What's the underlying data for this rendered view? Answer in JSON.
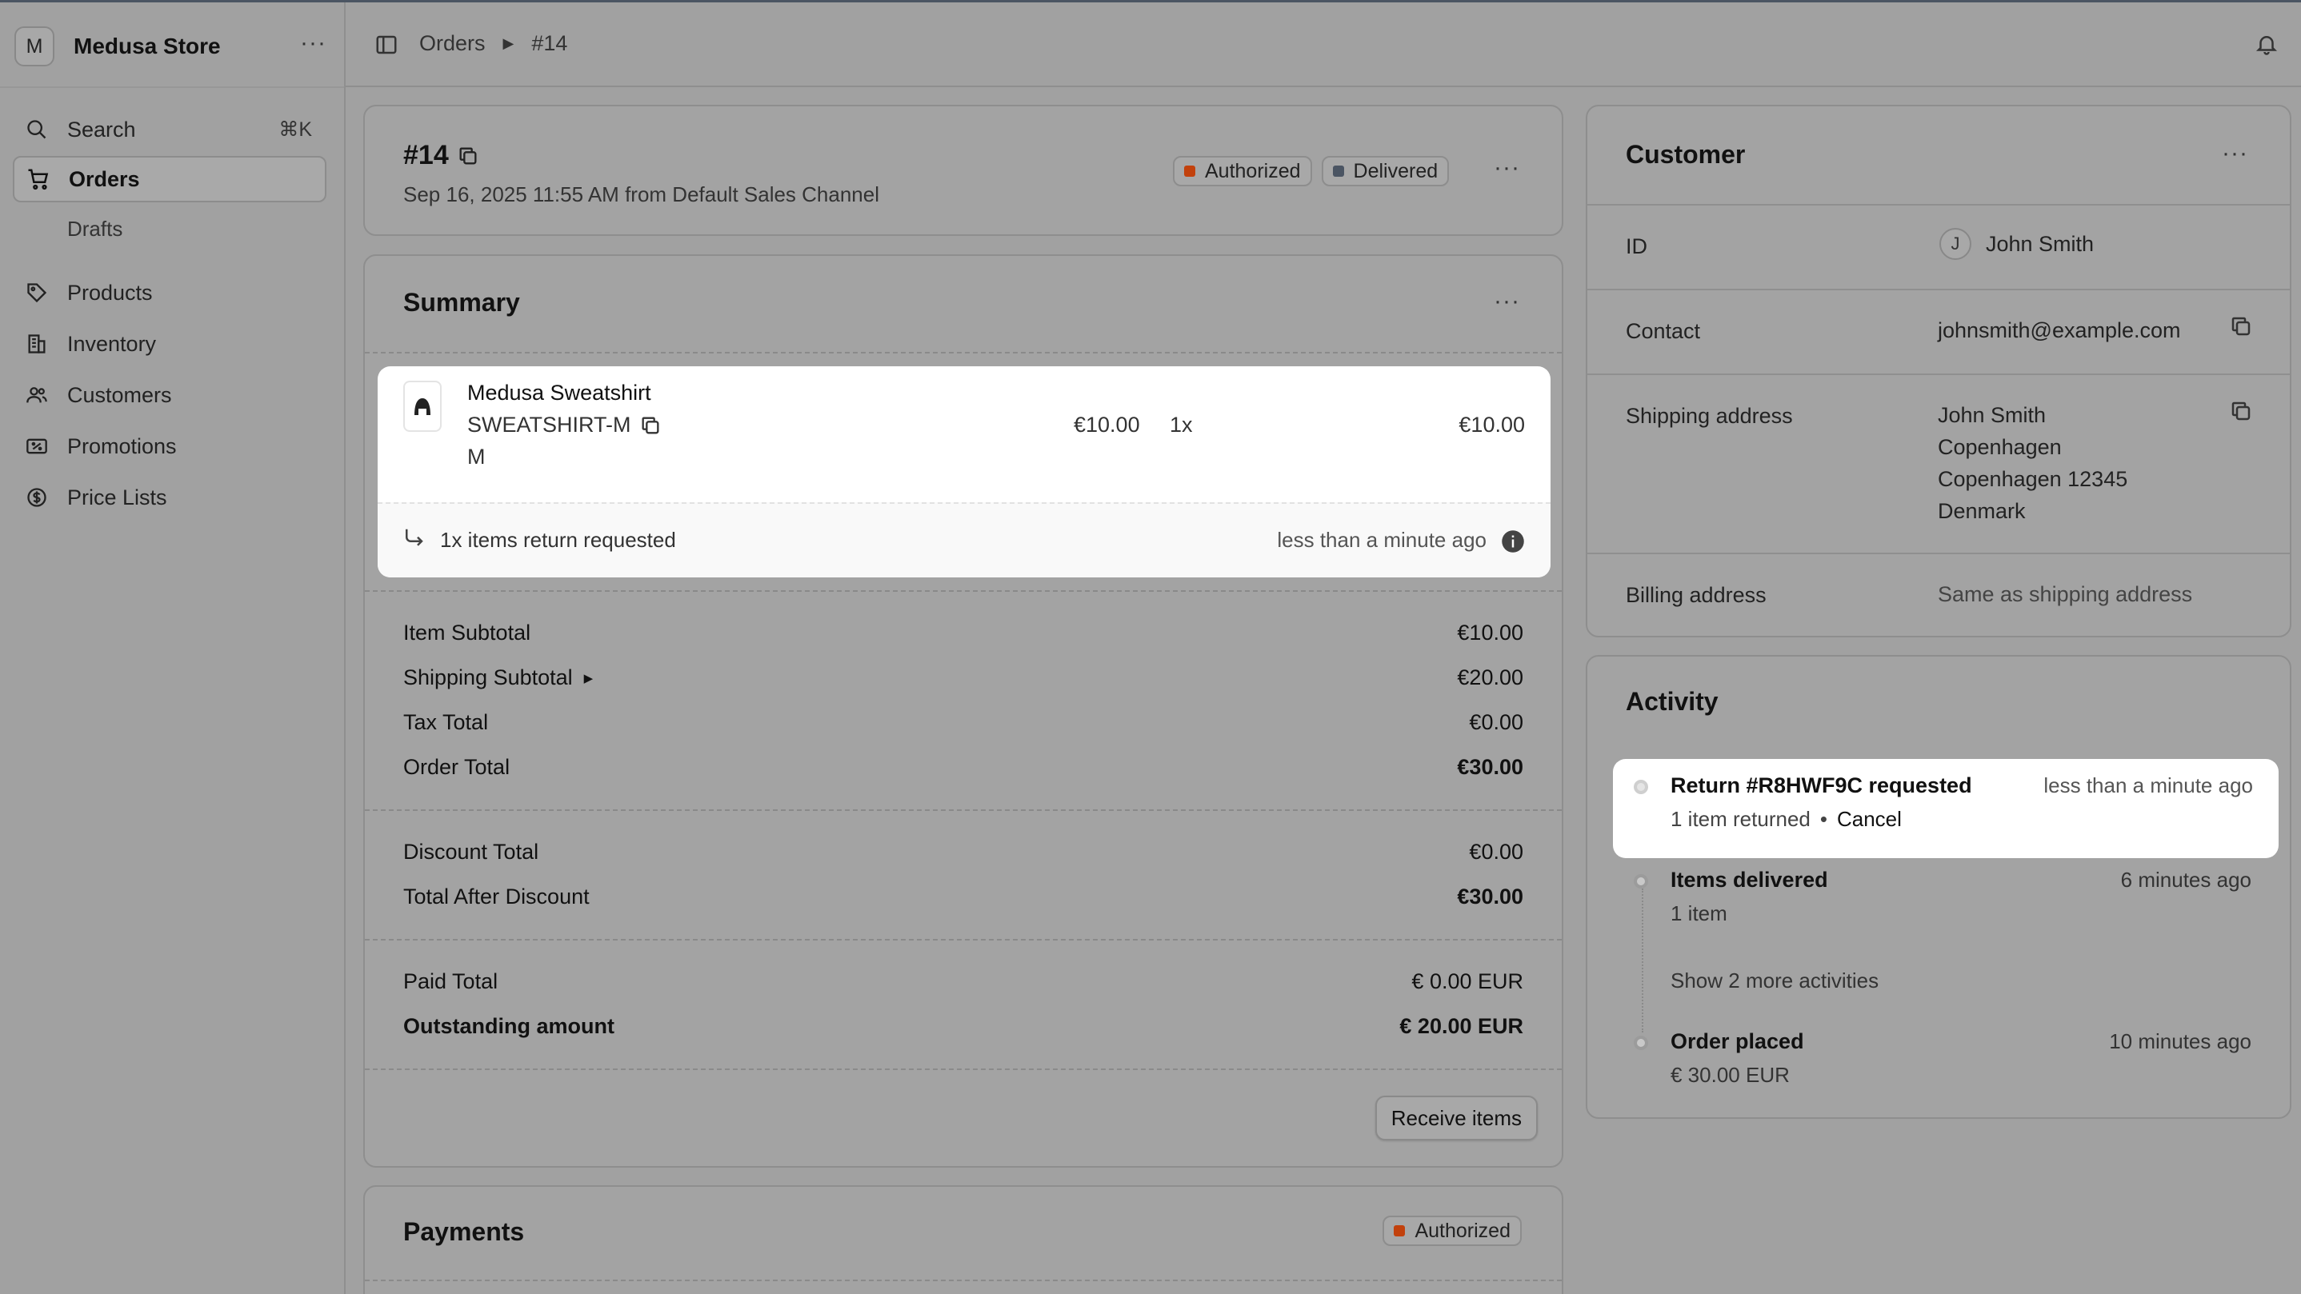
{
  "store": {
    "initial": "M",
    "name": "Medusa Store"
  },
  "nav": {
    "search_label": "Search",
    "search_shortcut": "⌘K",
    "orders": "Orders",
    "drafts": "Drafts",
    "products": "Products",
    "inventory": "Inventory",
    "customers": "Customers",
    "promotions": "Promotions",
    "price_lists": "Price Lists"
  },
  "breadcrumb": {
    "root": "Orders",
    "current": "#14"
  },
  "order": {
    "id": "#14",
    "subtitle": "Sep 16, 2025 11:55 AM from Default Sales Channel",
    "badges": [
      {
        "label": "Authorized",
        "color": "#c2410c"
      },
      {
        "label": "Delivered",
        "color": "#4b5563"
      }
    ]
  },
  "summary": {
    "title": "Summary",
    "item": {
      "name": "Medusa Sweatshirt",
      "sku": "SWEATSHIRT-M",
      "variant": "M",
      "unit_price": "€10.00",
      "quantity": "1x",
      "total": "€10.00"
    },
    "return_notice": {
      "text": "1x items return requested",
      "time": "less than a minute ago"
    },
    "totals": [
      {
        "label": "Item Subtotal",
        "value": "€10.00"
      },
      {
        "label": "Shipping Subtotal",
        "value": "€20.00"
      },
      {
        "label": "Tax Total",
        "value": "€0.00"
      },
      {
        "label": "Order Total",
        "value": "€30.00"
      }
    ],
    "discounts": [
      {
        "label": "Discount Total",
        "value": "€0.00"
      },
      {
        "label": "Total After Discount",
        "value": "€30.00"
      }
    ],
    "payments_totals": [
      {
        "label": "Paid Total",
        "value": "€ 0.00 EUR"
      },
      {
        "label": "Outstanding amount",
        "value": "€ 20.00 EUR"
      }
    ],
    "receive_button": "Receive items"
  },
  "payments": {
    "title": "Payments",
    "badge": "Authorized",
    "badge_color": "#c2410c"
  },
  "customer": {
    "title": "Customer",
    "id_label": "ID",
    "avatar_initial": "J",
    "name": "John Smith",
    "contact_label": "Contact",
    "email": "johnsmith@example.com",
    "shipping_label": "Shipping address",
    "shipping_lines": [
      "John Smith",
      "Copenhagen",
      "Copenhagen 12345",
      "Denmark"
    ],
    "billing_label": "Billing address",
    "billing_value": "Same as shipping address"
  },
  "activity": {
    "title": "Activity",
    "return": {
      "title": "Return #R8HWF9C requested",
      "time": "less than a minute ago",
      "detail": "1 item returned",
      "separator": "•",
      "cancel": "Cancel"
    },
    "delivered": {
      "title": "Items delivered",
      "time": "6 minutes ago",
      "detail": "1 item"
    },
    "show_more": "Show 2 more activities",
    "placed": {
      "title": "Order placed",
      "time": "10 minutes ago",
      "detail": "€ 30.00 EUR"
    }
  }
}
